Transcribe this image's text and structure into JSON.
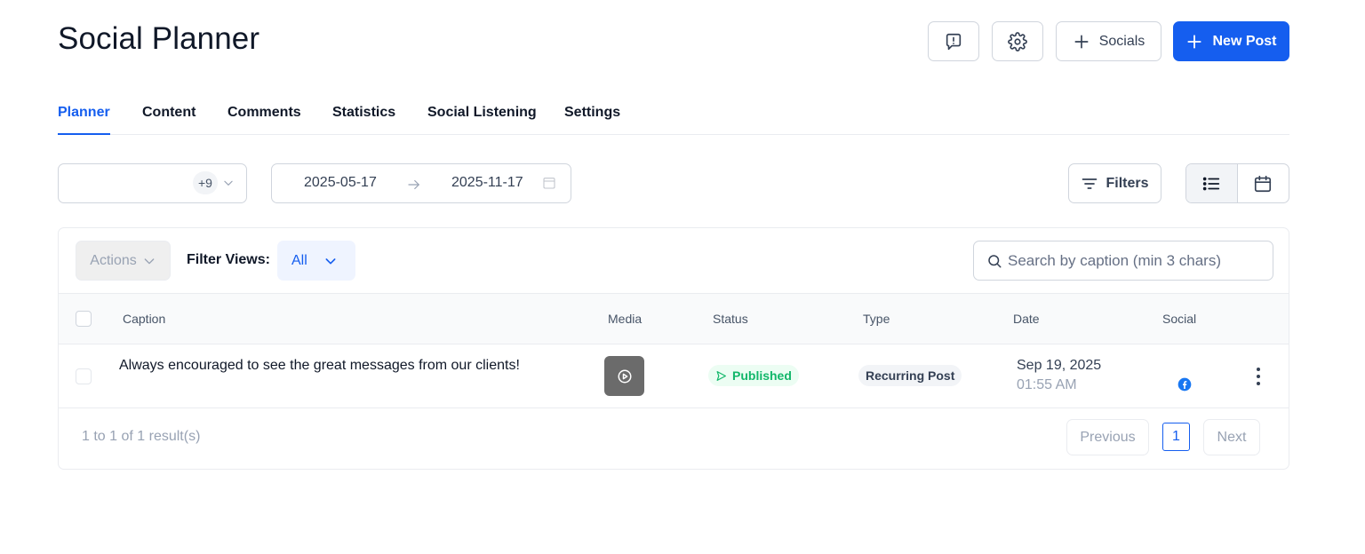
{
  "header": {
    "title": "Social Planner",
    "socials_label": "Socials",
    "new_post_label": "New Post"
  },
  "tabs": [
    {
      "label": "Planner",
      "active": true
    },
    {
      "label": "Content",
      "active": false
    },
    {
      "label": "Comments",
      "active": false
    },
    {
      "label": "Statistics",
      "active": false
    },
    {
      "label": "Social Listening",
      "active": false
    },
    {
      "label": "Settings",
      "active": false
    }
  ],
  "filters": {
    "accounts_badge": "+9",
    "date_start": "2025-05-17",
    "date_end": "2025-11-17",
    "filters_label": "Filters",
    "view_mode": "list"
  },
  "toolbar": {
    "actions_label": "Actions",
    "filter_views_label": "Filter Views:",
    "filter_views_value": "All",
    "search_placeholder": "Search by caption (min 3 chars)"
  },
  "table": {
    "columns": [
      "Caption",
      "Media",
      "Status",
      "Type",
      "Date",
      "Social"
    ],
    "rows": [
      {
        "caption": "Always encouraged to see the great messages from our clients!",
        "media": "video-icon",
        "status": "Published",
        "type": "Recurring Post",
        "date": "Sep 19, 2025",
        "time": "01:55 AM",
        "social": "facebook-icon"
      }
    ]
  },
  "pagination": {
    "summary": "1 to 1 of 1 result(s)",
    "previous_label": "Previous",
    "current_page": "1",
    "next_label": "Next"
  },
  "colors": {
    "primary": "#155eef",
    "published": "#12b76a",
    "facebook": "#1877f2"
  }
}
